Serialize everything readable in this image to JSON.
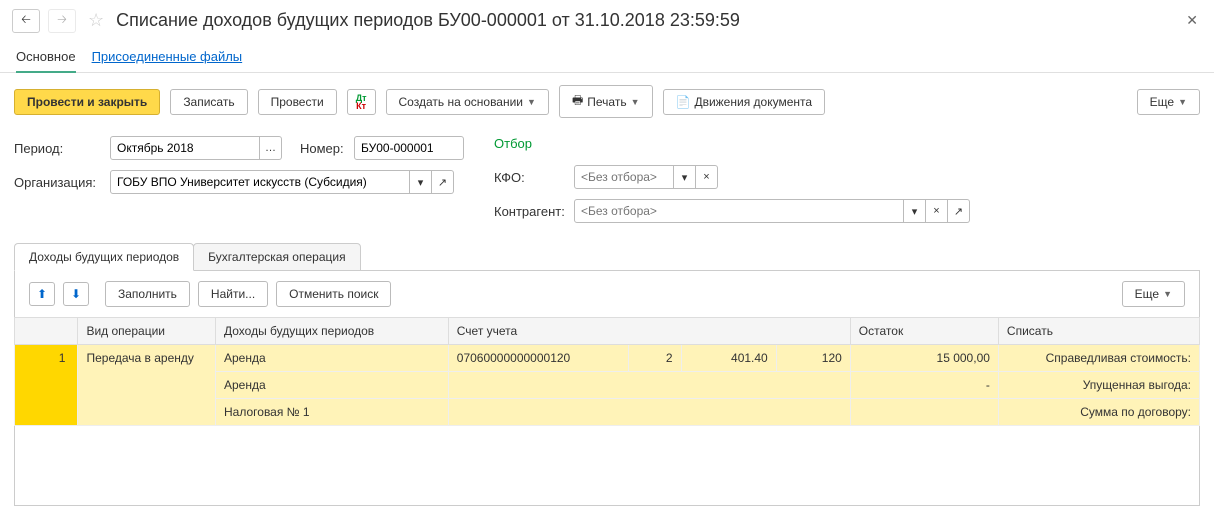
{
  "header": {
    "title": "Списание доходов будущих периодов БУ00-000001 от 31.10.2018 23:59:59"
  },
  "nav_tabs": {
    "main": "Основное",
    "files": "Присоединенные файлы"
  },
  "toolbar": {
    "post_close": "Провести и закрыть",
    "save": "Записать",
    "post": "Провести",
    "create_based": "Создать на основании",
    "print": "Печать",
    "movements": "Движения документа",
    "more": "Еще"
  },
  "form": {
    "period_label": "Период:",
    "period_value": "Октябрь 2018",
    "number_label": "Номер:",
    "number_value": "БУ00-000001",
    "org_label": "Организация:",
    "org_value": "ГОБУ ВПО Университет искусств (Субсидия)",
    "otbor_title": "Отбор",
    "kfo_label": "КФО:",
    "kfo_placeholder": "<Без отбора>",
    "contr_label": "Контрагент:",
    "contr_placeholder": "<Без отбора>"
  },
  "sub_tabs": {
    "incomes": "Доходы будущих периодов",
    "accounting": "Бухгалтерская операция"
  },
  "table_toolbar": {
    "fill": "Заполнить",
    "find": "Найти...",
    "cancel_search": "Отменить поиск",
    "more": "Еще"
  },
  "table": {
    "headers": {
      "op_type": "Вид операции",
      "incomes": "Доходы будущих периодов",
      "account": "Счет учета",
      "balance": "Остаток",
      "writeoff": "Списать"
    },
    "row": {
      "num": "1",
      "op_type": "Передача в аренду",
      "income1": "Аренда",
      "income2": "Аренда",
      "income3": "Налоговая № 1",
      "acc1": "07060000000000120",
      "acc2": "2",
      "acc3": "401.40",
      "acc4": "120",
      "balance": "15 000,00",
      "dash": "-",
      "writeoff1": "Справедливая стоимость:",
      "writeoff2": "Упущенная выгода:",
      "writeoff3": "Сумма по договору:"
    }
  }
}
